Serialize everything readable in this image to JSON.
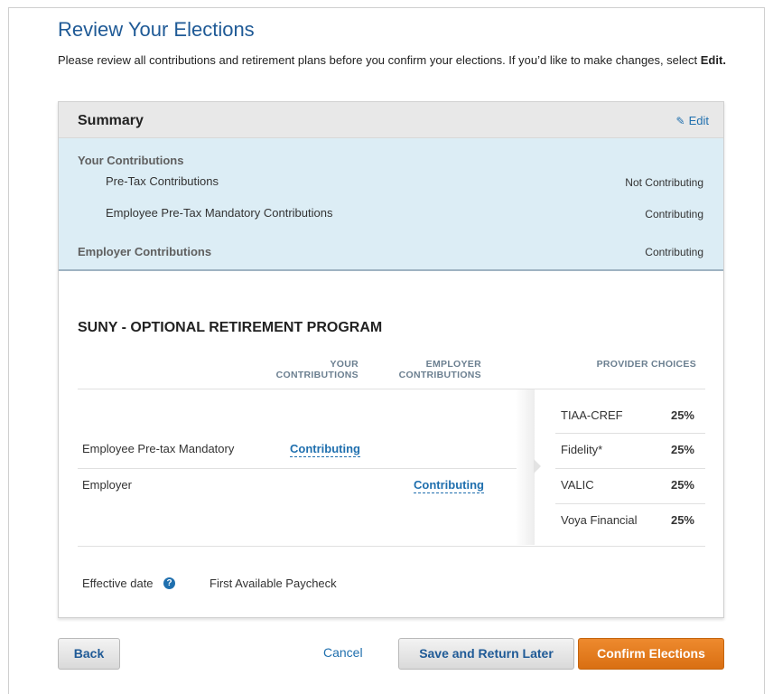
{
  "page": {
    "title": "Review Your Elections",
    "intro_text": "Please review all contributions and retirement plans before you confirm your elections. If you’d like to make changes, select",
    "intro_bold": "Edit."
  },
  "summary": {
    "title": "Summary",
    "edit_label": "Edit",
    "your_contributions_label": "Your Contributions",
    "rows": [
      {
        "label": "Pre-Tax Contributions",
        "status": "Not Contributing"
      },
      {
        "label": "Employee Pre-Tax Mandatory Contributions",
        "status": "Contributing"
      }
    ],
    "employer": {
      "label": "Employer Contributions",
      "status": "Contributing"
    }
  },
  "plan": {
    "title": "SUNY - OPTIONAL RETIREMENT PROGRAM",
    "headers": {
      "your_line1": "YOUR",
      "your_line2": "CONTRIBUTIONS",
      "employer_line1": "EMPLOYER",
      "employer_line2": "CONTRIBUTIONS",
      "provider": "PROVIDER CHOICES"
    },
    "rows": [
      {
        "label": "Employee Pre-tax Mandatory",
        "your": "Contributing",
        "employer": ""
      },
      {
        "label": "Employer",
        "your": "",
        "employer": "Contributing"
      }
    ],
    "providers": [
      {
        "name": "TIAA-CREF",
        "pct": "25%"
      },
      {
        "name": "Fidelity*",
        "pct": "25%"
      },
      {
        "name": "VALIC",
        "pct": "25%"
      },
      {
        "name": "Voya Financial",
        "pct": "25%"
      }
    ],
    "effective_label": "Effective date",
    "effective_value": "First Available Paycheck",
    "help_icon": "question-circle-icon"
  },
  "actions": {
    "back": "Back",
    "cancel": "Cancel",
    "save": "Save and Return Later",
    "confirm": "Confirm Elections"
  },
  "colors": {
    "title_blue": "#1f5a96",
    "link_blue": "#1f6fae",
    "summary_bg": "#dcedf5",
    "confirm_orange": "#e27d20"
  }
}
